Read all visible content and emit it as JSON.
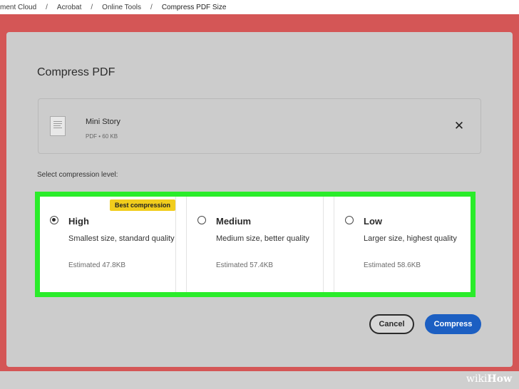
{
  "breadcrumb": {
    "items": [
      "ment Cloud",
      "Acrobat",
      "Online Tools",
      "Compress PDF Size"
    ],
    "separator": "/"
  },
  "dialog": {
    "title": "Compress PDF",
    "file": {
      "name": "Mini Story",
      "meta": "PDF • 60 KB",
      "thumbnail_icon": "document-thumbnail-icon",
      "close_icon": "close-icon",
      "close_glyph": "✕"
    },
    "level_label": "Select compression level:",
    "options": [
      {
        "title": "High",
        "description": "Smallest size, standard quality",
        "estimate": "Estimated 47.8KB",
        "selected": true,
        "badge": "Best compression"
      },
      {
        "title": "Medium",
        "description": "Medium size, better quality",
        "estimate": "Estimated 57.4KB",
        "selected": false
      },
      {
        "title": "Low",
        "description": "Larger size, highest quality",
        "estimate": "Estimated 58.6KB",
        "selected": false
      }
    ],
    "buttons": {
      "cancel_label": "Cancel",
      "compress_label": "Compress"
    }
  },
  "watermark": {
    "wiki": "wiki",
    "how": "How"
  },
  "colors": {
    "background": "#d45656",
    "highlight": "#2aec2a",
    "primary_button": "#1c5fc2",
    "badge": "#f1cd1d"
  }
}
